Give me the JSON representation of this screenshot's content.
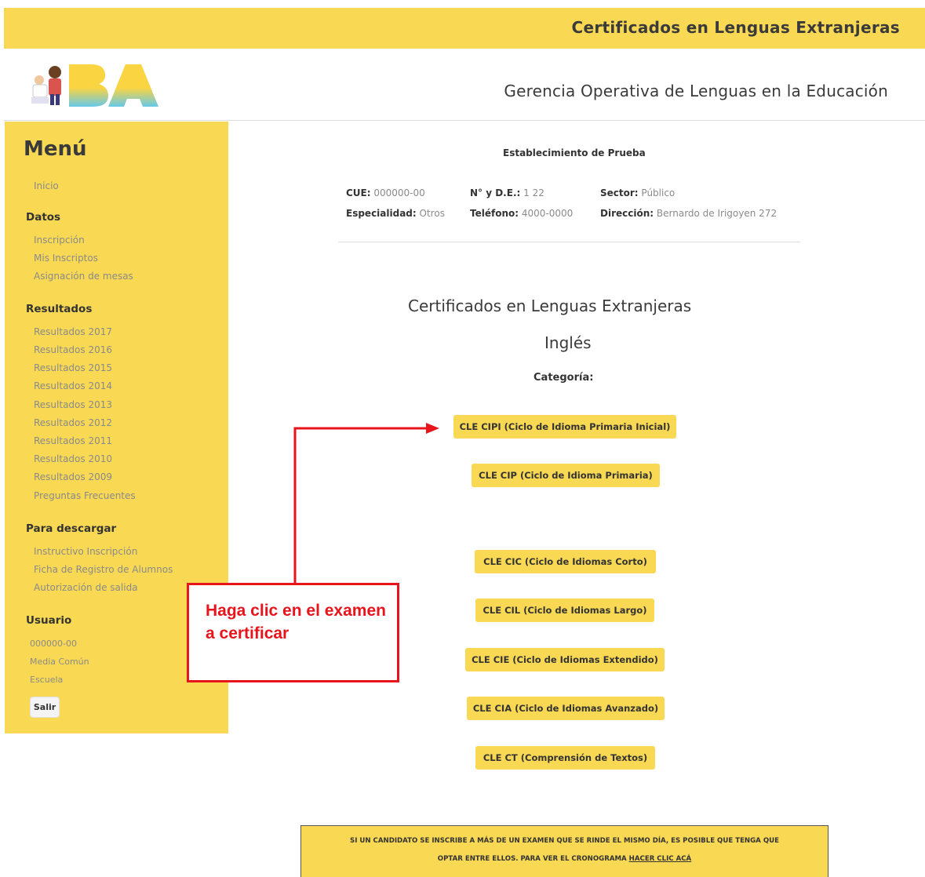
{
  "topbar": {
    "title": "Certificados en Lenguas Extranjeras"
  },
  "header": {
    "subtitle": "Gerencia Operativa de Lenguas en la Educación",
    "logo_text": "BA"
  },
  "sidebar": {
    "menu_title": "Menú",
    "inicio": "Inicio",
    "datos_heading": "Datos",
    "datos_items": [
      "Inscripción",
      "Mis Inscriptos",
      "Asignación de mesas"
    ],
    "resultados_heading": "Resultados",
    "resultados_items": [
      "Resultados 2017",
      "Resultados 2016",
      "Resultados 2015",
      "Resultados 2014",
      "Resultados 2013",
      "Resultados 2012",
      "Resultados 2011",
      "Resultados 2010",
      "Resultados 2009",
      "Preguntas Frecuentes"
    ],
    "descargar_heading": "Para descargar",
    "descargar_items": [
      "Instructivo Inscripción",
      "Ficha de Registro de Alumnos",
      "Autorización de salida"
    ],
    "usuario_heading": "Usuario",
    "usuario_items": [
      "000000-00",
      "Media Común",
      "Escuela"
    ],
    "salir_label": "Salir"
  },
  "school": {
    "name": "Establecimiento de Prueba",
    "cue_label": "CUE:",
    "cue_value": "000000-00",
    "nde_label": "N° y D.E.:",
    "nde_value": "1 22",
    "sector_label": "Sector:",
    "sector_value": "Público",
    "especialidad_label": "Especialidad:",
    "especialidad_value": "Otros",
    "telefono_label": "Teléfono:",
    "telefono_value": "4000-0000",
    "direccion_label": "Dirección:",
    "direccion_value": "Bernardo de Irigoyen 272"
  },
  "main": {
    "title": "Certificados en Lenguas Extranjeras",
    "language": "Inglés",
    "category_label": "Categoría:",
    "exams": [
      "CLE CIPI (Ciclo de Idioma Primaria Inicial)",
      "CLE CIP (Ciclo de Idioma Primaria)",
      "CLE CIC (Ciclo de Idiomas Corto)",
      "CLE CIL (Ciclo de Idiomas Largo)",
      "CLE CIE (Ciclo de Idiomas Extendido)",
      "CLE CIA (Ciclo de Idiomas Avanzado)",
      "CLE CT (Comprensión de Textos)"
    ]
  },
  "callout": {
    "text": "Haga clic en el examen a certificar"
  },
  "notice": {
    "line1": "SI UN CANDIDATO SE INSCRIBE A MÁS DE UN EXAMEN QUE SE RINDE EL MISMO DÍA, ES POSIBLE QUE TENGA QUE",
    "line2": "OPTAR ENTRE ELLOS. PARA VER EL CRONOGRAMA",
    "link": "HACER CLIC ACÁ"
  },
  "colors": {
    "brand_yellow": "#f9d853",
    "callout_red": "#e8141c"
  }
}
